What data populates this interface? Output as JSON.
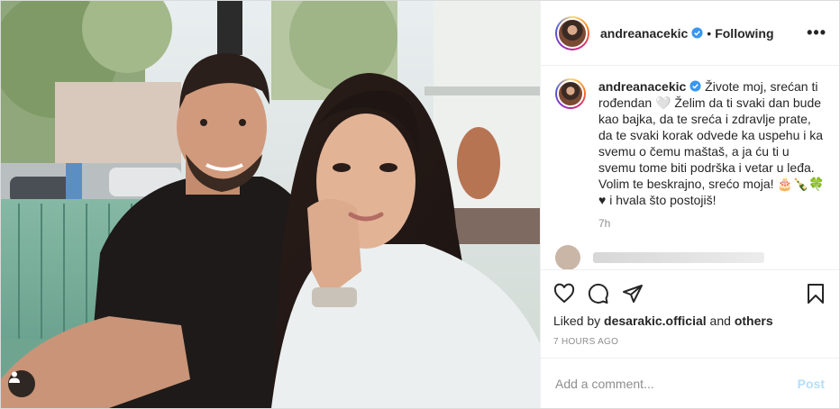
{
  "post": {
    "username": "andreanacekic",
    "separator": "•",
    "follow_status": "Following",
    "more_label": "•••",
    "caption_text": " Živote moj, srećan ti rođendan 🤍 Želim da ti svaki dan bude kao bajka, da te sreća i zdravlje prate, da te svaki korak odvede ka uspehu i ka svemu o čemu maštaš, a ja ću ti u svemu tome biti podrška i vetar u leđa. Volim te beskrajno, srećo moja! 🎂🍾🍀♥ i hvala što postojiš!",
    "caption_time": "7h",
    "liked_by_prefix": "Liked by ",
    "liked_by_user": "desarakic.official",
    "liked_by_suffix": " and ",
    "liked_by_others": "others",
    "posted_ago": "7 HOURS AGO",
    "comment_placeholder": "Add a comment...",
    "post_button": "Post"
  },
  "icons": {
    "like": "heart-icon",
    "comment": "comment-icon",
    "share": "share-icon",
    "save": "bookmark-icon",
    "verified": "verified-badge-icon",
    "user_tag": "user-tag-icon"
  },
  "colors": {
    "verified": "#3897f0",
    "post_button": "#b2dffc",
    "muted": "#8e8e8e"
  }
}
